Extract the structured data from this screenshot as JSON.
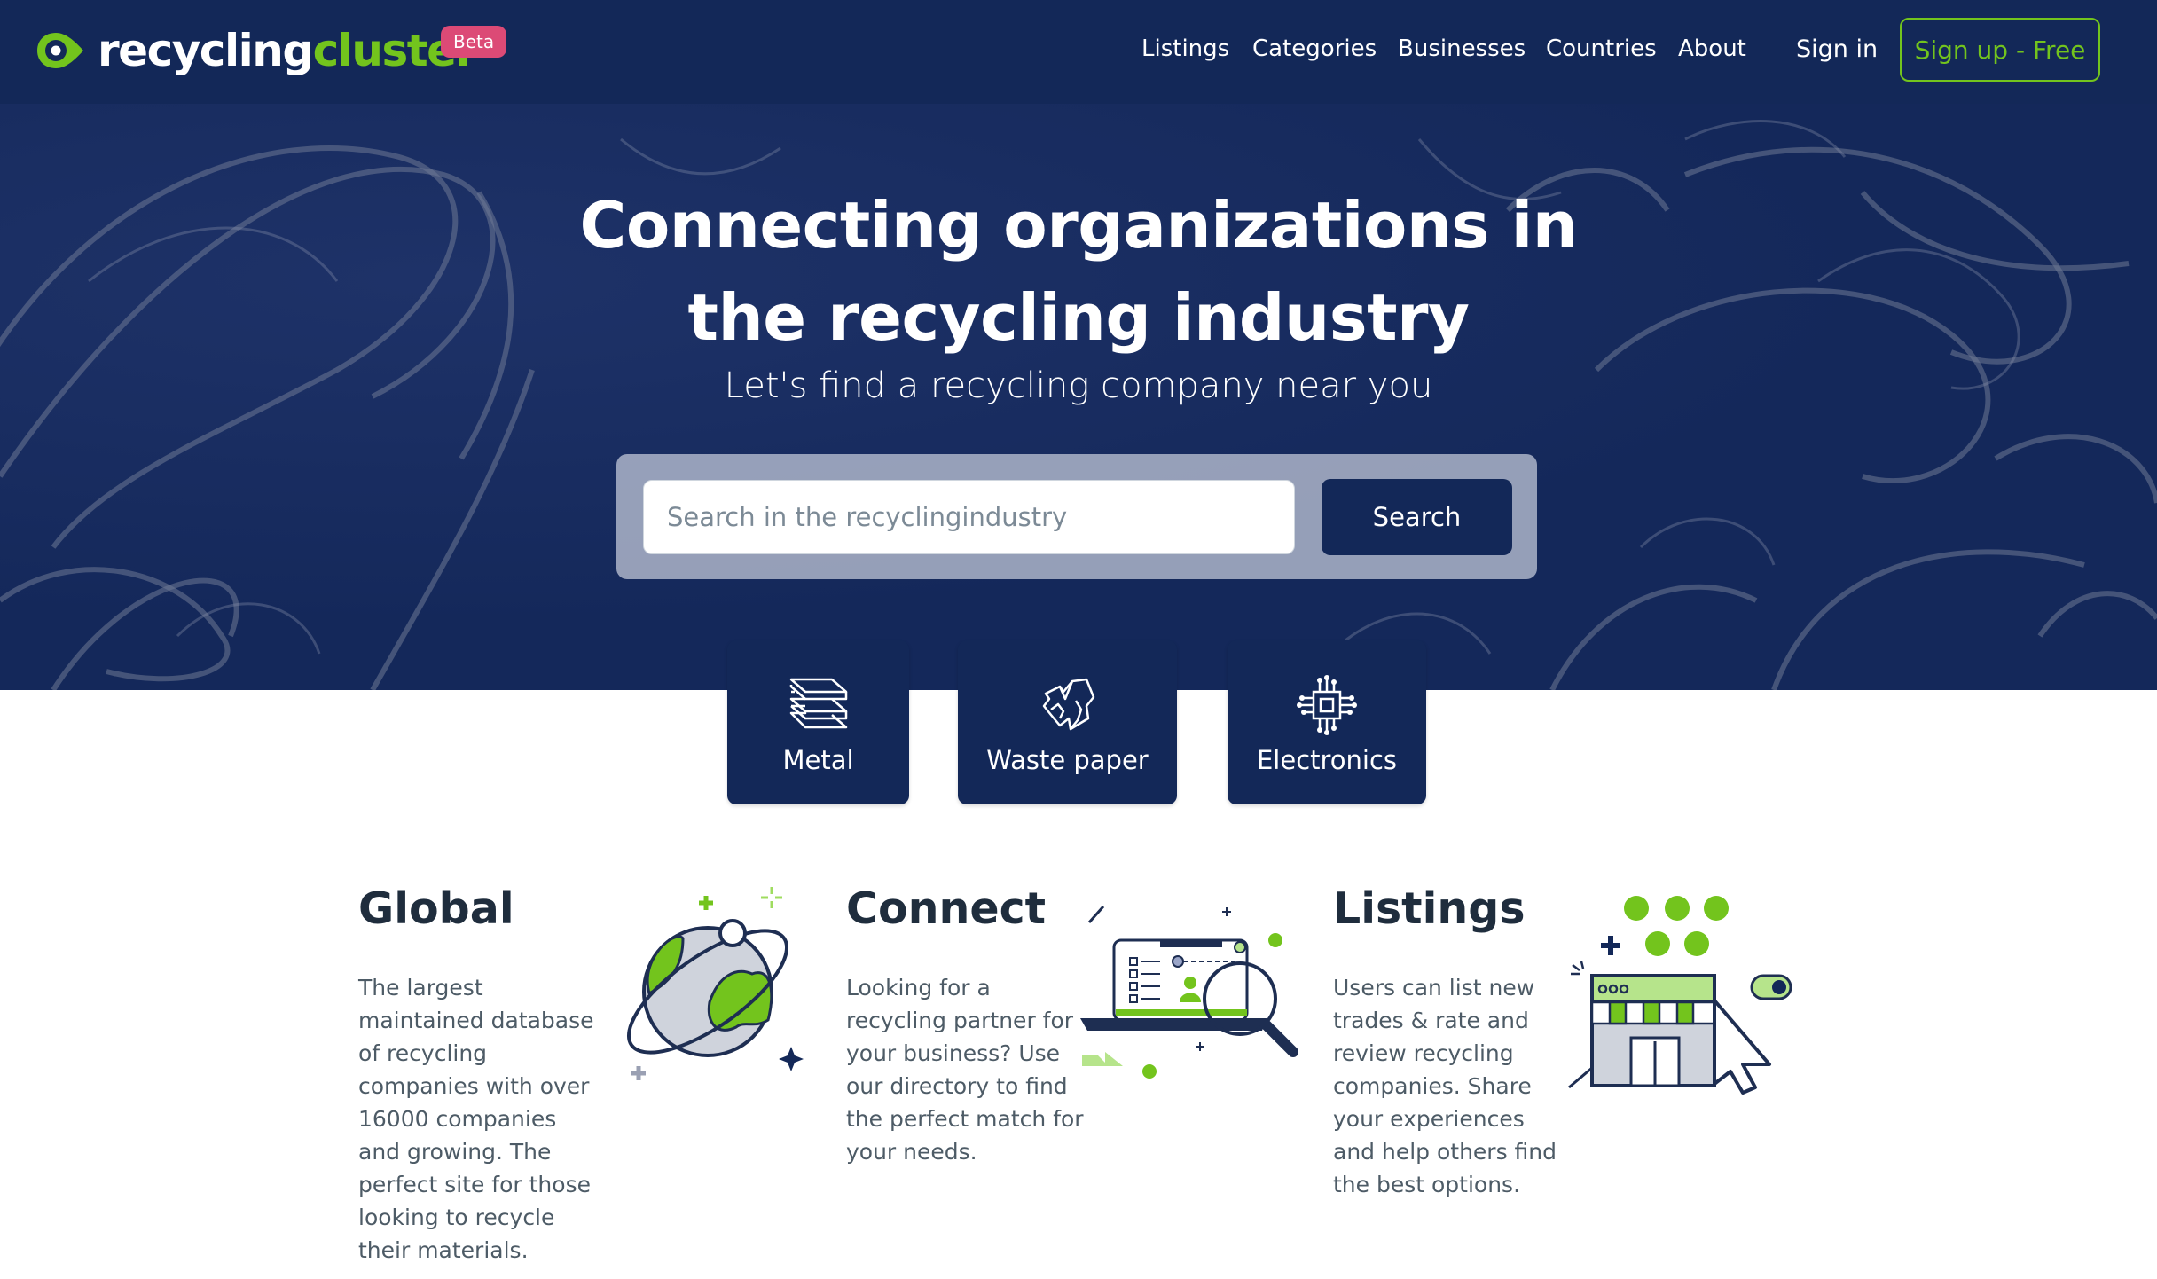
{
  "brand": {
    "name_part1": "recycling",
    "name_part2": "cluster",
    "badge": "Beta",
    "colors": {
      "navy": "#132858",
      "green": "#73c41d",
      "badge": "#dc4a76"
    }
  },
  "nav": {
    "links": [
      "Listings",
      "Categories",
      "Businesses",
      "Countries",
      "About"
    ],
    "sign_in": "Sign in",
    "sign_up": "Sign up - Free"
  },
  "hero": {
    "title_line1": "Connecting organizations in",
    "title_line2": "the recycling industry",
    "subtitle": "Let's find a recycling company near you",
    "search": {
      "placeholder": "Search in the recyclingindustry",
      "value": "",
      "button": "Search"
    }
  },
  "categories": [
    {
      "label": "Metal",
      "icon": "metal-sheets-icon"
    },
    {
      "label": "Waste paper",
      "icon": "crumpled-paper-icon"
    },
    {
      "label": "Electronics",
      "icon": "circuit-chip-icon"
    }
  ],
  "features": [
    {
      "title": "Global",
      "text": "The largest maintained database of recycling companies with over 16000 companies and growing. The perfect site for those looking to recycle their materials.",
      "illustration": "globe-illustration"
    },
    {
      "title": "Connect",
      "text": "Looking for a recycling partner for your business? Use our directory to find the perfect match for your needs.",
      "illustration": "laptop-search-illustration"
    },
    {
      "title": "Listings",
      "text": "Users can list new trades & rate and review recycling companies. Share your experiences and help others find the best options.",
      "illustration": "storefront-rating-illustration"
    }
  ]
}
